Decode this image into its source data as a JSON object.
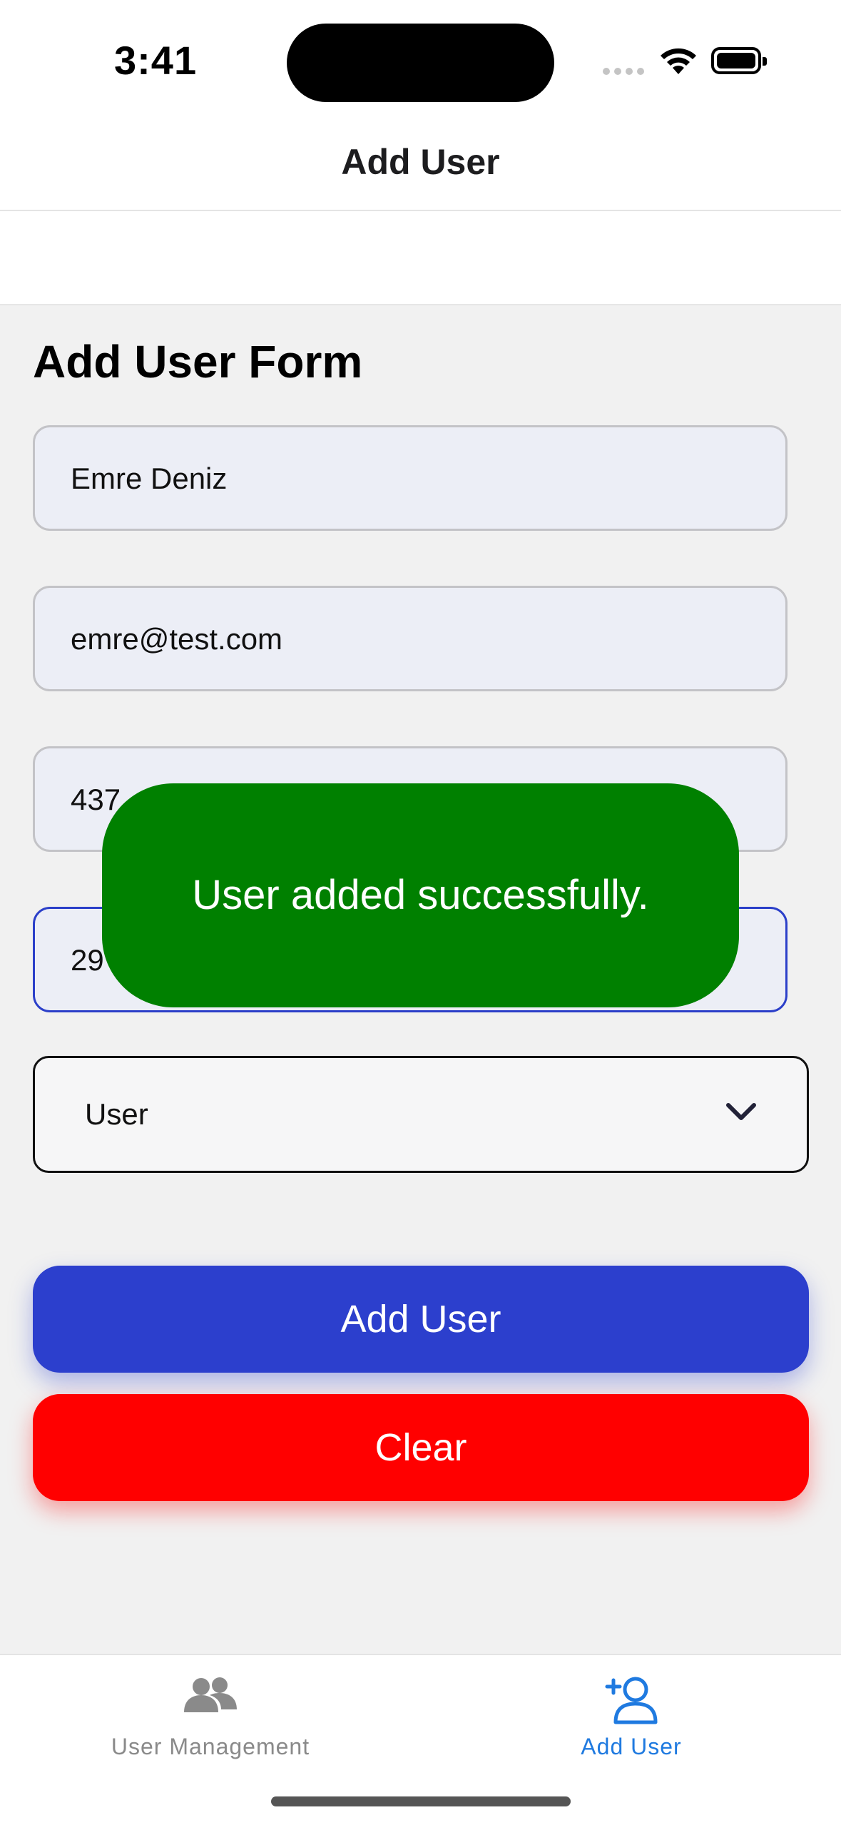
{
  "status_bar": {
    "time": "3:41"
  },
  "header": {
    "title": "Add User"
  },
  "form": {
    "title": "Add User Form",
    "fields": [
      {
        "value": "Emre Deniz"
      },
      {
        "value": "emre@test.com"
      },
      {
        "value": "437"
      },
      {
        "value": "29"
      }
    ],
    "role_select": {
      "selected": "User"
    },
    "add_button_label": "Add User",
    "clear_button_label": "Clear"
  },
  "toast": {
    "message": "User added successfully.",
    "color": "#008000"
  },
  "tab_bar": {
    "items": [
      {
        "label": "User Management",
        "icon": "users-icon",
        "active": false
      },
      {
        "label": "Add User",
        "icon": "add-user-icon",
        "active": true
      }
    ]
  },
  "colors": {
    "primary": "#2c3fcd",
    "danger": "#ff0000",
    "success": "#008000",
    "tab_active": "#1f7ae0"
  }
}
